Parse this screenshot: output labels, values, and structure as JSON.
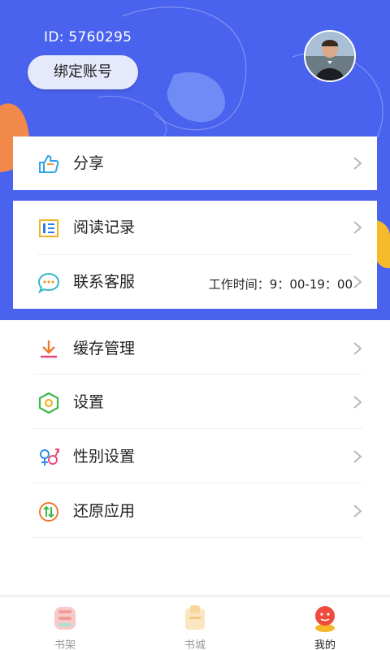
{
  "header": {
    "user_id": "ID: 5760295",
    "bind_account": "绑定账号",
    "bg_color": "#4a63ee"
  },
  "menu": {
    "share": {
      "label": "分享",
      "icon": "thumbs-up-icon"
    },
    "reading_history": {
      "label": "阅读记录",
      "icon": "list-icon"
    },
    "customer_service": {
      "label": "联系客服",
      "icon": "chat-icon",
      "hours": "工作时间：9：00-19：00"
    },
    "cache_management": {
      "label": "缓存管理",
      "icon": "download-icon"
    },
    "settings": {
      "label": "设置",
      "icon": "hexagon-settings-icon"
    },
    "gender_settings": {
      "label": "性别设置",
      "icon": "gender-icon"
    },
    "restore_app": {
      "label": "还原应用",
      "icon": "restore-icon"
    }
  },
  "tabbar": {
    "tabs": [
      {
        "label": "书架",
        "icon": "bookshelf-icon"
      },
      {
        "label": "书城",
        "icon": "bookstore-icon"
      },
      {
        "label": "我的",
        "icon": "profile-icon",
        "active": true
      }
    ]
  }
}
